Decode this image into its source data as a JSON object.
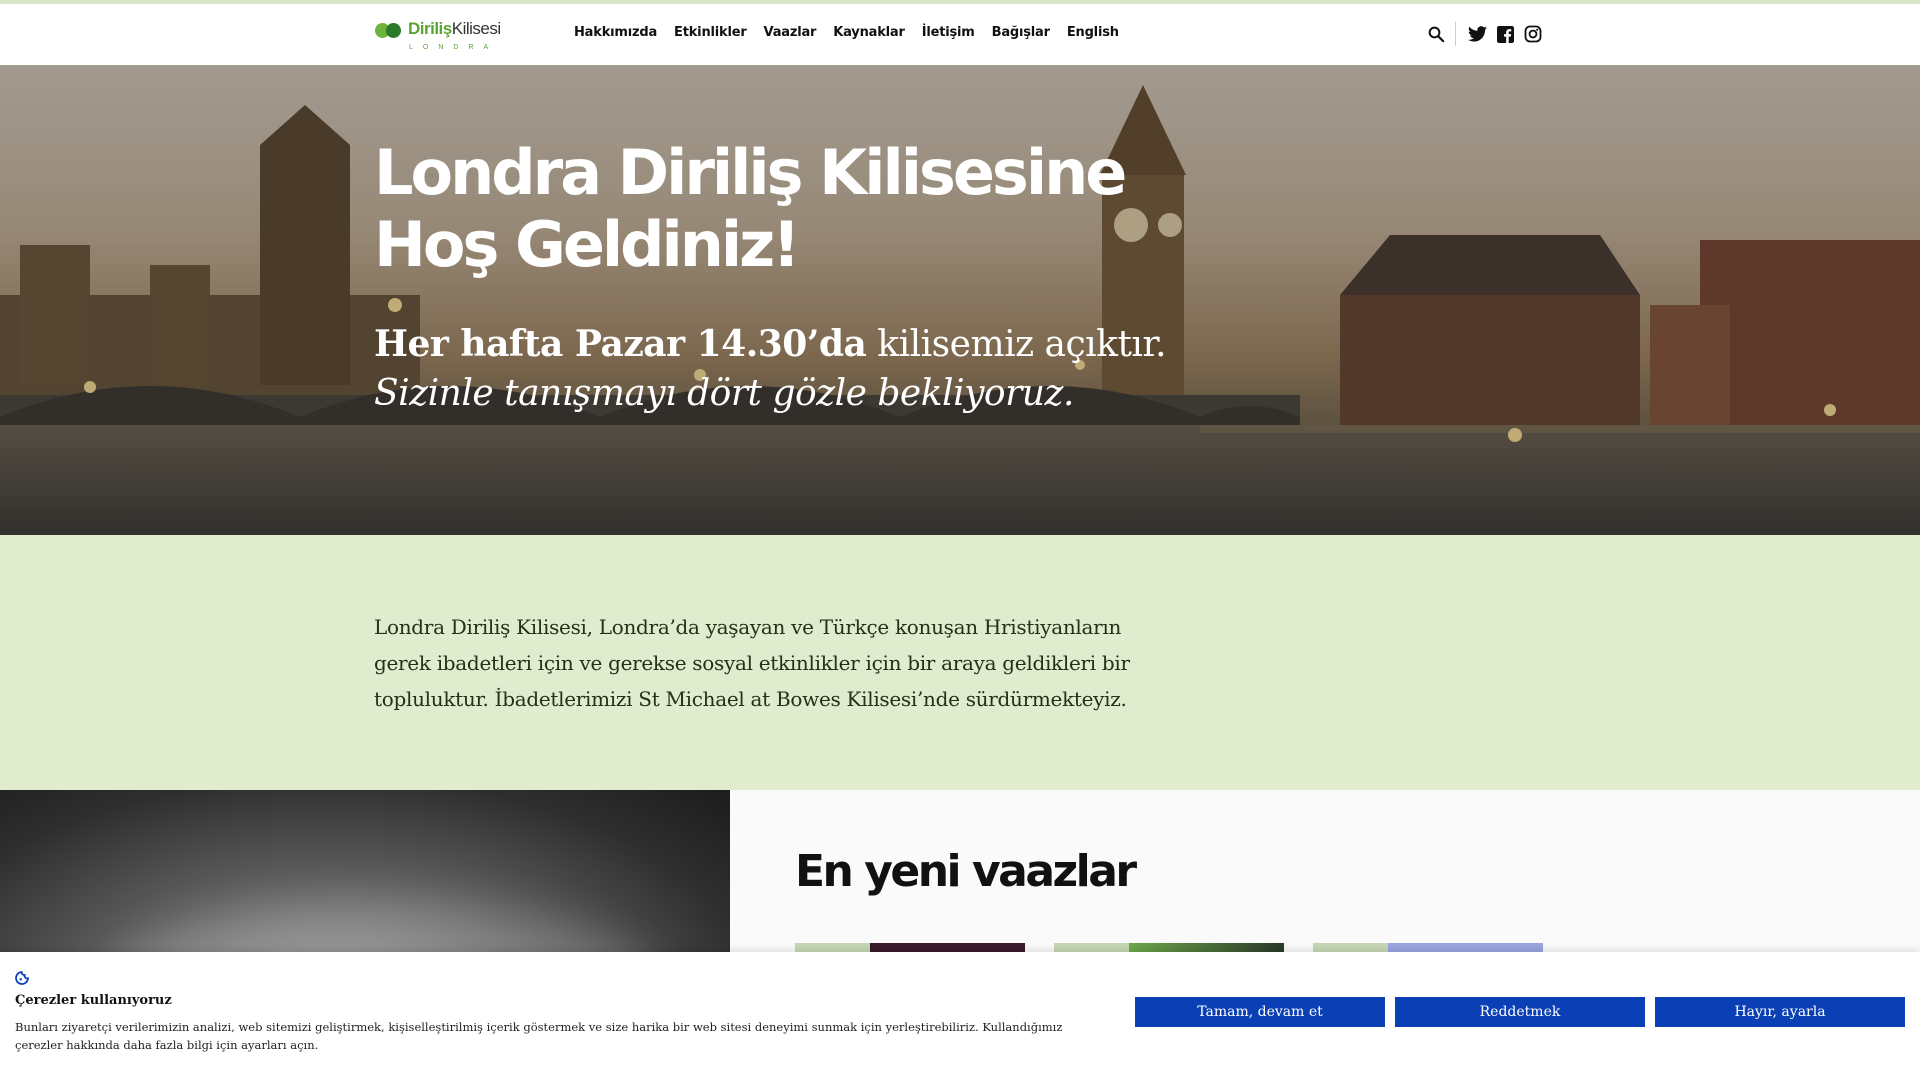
{
  "header": {
    "logo": {
      "word1": "Diriliş",
      "word2": "Kilisesi",
      "sub": "LONDRA"
    },
    "nav": [
      "Hakkımızda",
      "Etkinlikler",
      "Vaazlar",
      "Kaynaklar",
      "İletişim",
      "Bağışlar",
      "English"
    ],
    "icons": [
      "search-icon",
      "twitter-icon",
      "facebook-icon",
      "instagram-icon"
    ]
  },
  "hero": {
    "title_line1": "Londra Diriliş Kilisesine",
    "title_line2": "Hoş Geldiniz!",
    "line1_bold": "Her hafta Pazar 14.30’da",
    "line1_rest": " kilisemiz açıktır.",
    "line2": "Sizinle tanışmayı dört gözle bekliyoruz."
  },
  "intro": {
    "text": "Londra Diriliş Kilisesi, Londra’da yaşayan ve Türkçe konuşan Hristiyanların gerek ibadetleri için ve gerekse sosyal etkinlikler için bir araya geldikleri bir topluluktur. İbadetlerimizi St Michael at Bowes Kilisesi’nde sürdürmekteyiz."
  },
  "sermons": {
    "title": "En yeni vaazlar"
  },
  "cookie": {
    "icon": "cookie-icon",
    "title": "Çerezler kullanıyoruz",
    "text": "Bunları ziyaretçi verilerimizin analizi, web sitemizi geliştirmek, kişiselleştirilmiş içerik göstermek ve size harika bir web sitesi deneyimi sunmak için yerleştirebiliriz. Kullandığımız çerezler hakkında daha fazla bilgi için ayarları açın.",
    "accept": "Tamam, devam et",
    "reject": "Reddetmek",
    "settings": "Hayır, ayarla"
  },
  "colors": {
    "brand_green": "#5aa532",
    "intro_bg": "#e1ecce",
    "cookie_button": "#0b3fb5"
  }
}
